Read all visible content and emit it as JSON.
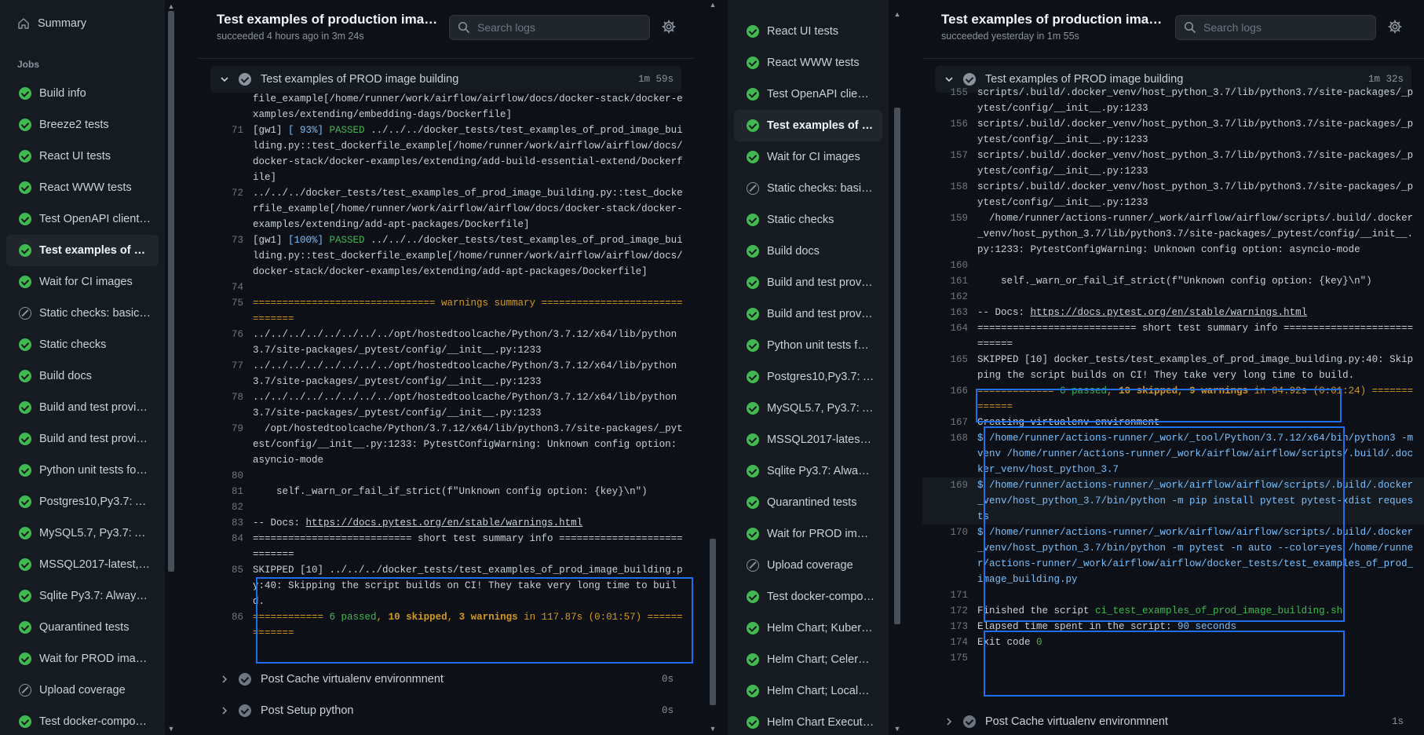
{
  "left_sidebar": {
    "summary_label": "Summary",
    "jobs_heading": "Jobs",
    "jobs": [
      {
        "label": "Build info",
        "status": "success"
      },
      {
        "label": "Breeze2 tests",
        "status": "success"
      },
      {
        "label": "React UI tests",
        "status": "success"
      },
      {
        "label": "React WWW tests",
        "status": "success"
      },
      {
        "label": "Test OpenAPI client …",
        "status": "success"
      },
      {
        "label": "Test examples of pr…",
        "status": "success",
        "active": true
      },
      {
        "label": "Wait for CI images",
        "status": "success"
      },
      {
        "label": "Static checks: basic c…",
        "status": "skipped"
      },
      {
        "label": "Static checks",
        "status": "success"
      },
      {
        "label": "Build docs",
        "status": "success"
      },
      {
        "label": "Build and test provid…",
        "status": "success"
      },
      {
        "label": "Build and test provid…",
        "status": "success"
      },
      {
        "label": "Python unit tests for …",
        "status": "success"
      },
      {
        "label": "Postgres10,Py3.7: Al…",
        "status": "success"
      },
      {
        "label": "MySQL5.7, Py3.7: Al…",
        "status": "success"
      },
      {
        "label": "MSSQL2017-latest, …",
        "status": "success"
      },
      {
        "label": "Sqlite Py3.7: Always …",
        "status": "success"
      },
      {
        "label": "Quarantined tests",
        "status": "success"
      },
      {
        "label": "Wait for PROD images",
        "status": "success"
      },
      {
        "label": "Upload coverage",
        "status": "skipped"
      },
      {
        "label": "Test docker-compose…",
        "status": "success"
      }
    ]
  },
  "left_log": {
    "title": "Test examples of production image …",
    "subtitle": "succeeded 4 hours ago in 3m 24s",
    "search_placeholder": "Search logs",
    "step": {
      "name": "Test examples of PROD image building",
      "duration": "1m 59s"
    },
    "lines": [
      {
        "n": "",
        "segs": [
          {
            "t": "file_example[/home/runner/work/airflow/airflow/docs/docker-stack/docker-examples/extending/embedding-dags/Dockerfile]"
          }
        ]
      },
      {
        "n": "71",
        "segs": [
          {
            "t": "[gw1] "
          },
          {
            "t": "[ 93%]",
            "c": "c"
          },
          {
            "t": " "
          },
          {
            "t": "PASSED",
            "c": "g"
          },
          {
            "t": " ../../../docker_tests/test_examples_of_prod_image_building.py::test_dockerfile_example[/home/runner/work/airflow/airflow/docs/docker-stack/docker-examples/extending/add-build-essential-extend/Dockerfile]"
          }
        ]
      },
      {
        "n": "72",
        "segs": [
          {
            "t": "../../../docker_tests/test_examples_of_prod_image_building.py::test_dockerfile_example[/home/runner/work/airflow/airflow/docs/docker-stack/docker-examples/extending/add-apt-packages/Dockerfile]"
          }
        ]
      },
      {
        "n": "73",
        "segs": [
          {
            "t": "[gw1] "
          },
          {
            "t": "[100%]",
            "c": "c"
          },
          {
            "t": " "
          },
          {
            "t": "PASSED",
            "c": "g"
          },
          {
            "t": " ../../../docker_tests/test_examples_of_prod_image_building.py::test_dockerfile_example[/home/runner/work/airflow/airflow/docs/docker-stack/docker-examples/extending/add-apt-packages/Dockerfile]"
          }
        ]
      },
      {
        "n": "74",
        "segs": [
          {
            "t": ""
          }
        ]
      },
      {
        "n": "75",
        "segs": [
          {
            "t": "=============================== warnings summary ===============================",
            "c": "y"
          }
        ]
      },
      {
        "n": "76",
        "segs": [
          {
            "t": "../../../../../../../../opt/hostedtoolcache/Python/3.7.12/x64/lib/python3.7/site-packages/_pytest/config/__init__.py:1233"
          }
        ]
      },
      {
        "n": "77",
        "segs": [
          {
            "t": "../../../../../../../../opt/hostedtoolcache/Python/3.7.12/x64/lib/python3.7/site-packages/_pytest/config/__init__.py:1233"
          }
        ]
      },
      {
        "n": "78",
        "segs": [
          {
            "t": "../../../../../../../../opt/hostedtoolcache/Python/3.7.12/x64/lib/python3.7/site-packages/_pytest/config/__init__.py:1233"
          }
        ]
      },
      {
        "n": "79",
        "segs": [
          {
            "t": "  /opt/hostedtoolcache/Python/3.7.12/x64/lib/python3.7/site-packages/_pytest/config/__init__.py:1233: PytestConfigWarning: Unknown config option: asyncio-mode"
          }
        ]
      },
      {
        "n": "80",
        "segs": [
          {
            "t": ""
          }
        ]
      },
      {
        "n": "81",
        "segs": [
          {
            "t": "    self._warn_or_fail_if_strict(f\"Unknown config option: {key}\\n\")"
          }
        ]
      },
      {
        "n": "82",
        "segs": [
          {
            "t": ""
          }
        ]
      },
      {
        "n": "83",
        "segs": [
          {
            "t": "-- Docs: "
          },
          {
            "t": "https://docs.pytest.org/en/stable/warnings.html",
            "c": "u"
          }
        ]
      },
      {
        "n": "84",
        "segs": [
          {
            "t": "=========================== short test summary info ============================"
          }
        ]
      },
      {
        "n": "85",
        "segs": [
          {
            "t": "SKIPPED [10] ../../../docker_tests/test_examples_of_prod_image_building.py:40: Skipping the script builds on CI! They take very long time to build."
          }
        ]
      },
      {
        "n": "86",
        "segs": [
          {
            "t": "============ ",
            "c": "y"
          },
          {
            "t": "6 passed",
            "c": "g"
          },
          {
            "t": ", ",
            "c": "y"
          },
          {
            "t": "10 skipped",
            "c": "y b"
          },
          {
            "t": ", ",
            "c": "y"
          },
          {
            "t": "3 warnings",
            "c": "y b"
          },
          {
            "t": " in 117.87s (0:01:57) =============",
            "c": "y"
          }
        ]
      }
    ],
    "post_steps": [
      {
        "name": "Post Cache virtualenv environmnent",
        "duration": "0s"
      },
      {
        "name": "Post Setup python",
        "duration": "0s"
      }
    ]
  },
  "mid_sidebar": {
    "jobs": [
      {
        "label": "React UI tests",
        "status": "success"
      },
      {
        "label": "React WWW tests",
        "status": "success"
      },
      {
        "label": "Test OpenAPI client …",
        "status": "success"
      },
      {
        "label": "Test examples of pr…",
        "status": "success",
        "active": true
      },
      {
        "label": "Wait for CI images",
        "status": "success"
      },
      {
        "label": "Static checks: basic c…",
        "status": "skipped"
      },
      {
        "label": "Static checks",
        "status": "success"
      },
      {
        "label": "Build docs",
        "status": "success"
      },
      {
        "label": "Build and test provid…",
        "status": "success"
      },
      {
        "label": "Build and test provid…",
        "status": "success"
      },
      {
        "label": "Python unit tests for …",
        "status": "success"
      },
      {
        "label": "Postgres10,Py3.7: Al…",
        "status": "success"
      },
      {
        "label": "MySQL5.7, Py3.7: Al…",
        "status": "success"
      },
      {
        "label": "MSSQL2017-latest, …",
        "status": "success"
      },
      {
        "label": "Sqlite Py3.7: Always …",
        "status": "success"
      },
      {
        "label": "Quarantined tests",
        "status": "success"
      },
      {
        "label": "Wait for PROD images",
        "status": "success"
      },
      {
        "label": "Upload coverage",
        "status": "skipped"
      },
      {
        "label": "Test docker-compose…",
        "status": "success"
      },
      {
        "label": "Helm Chart; Kuberne…",
        "status": "success"
      },
      {
        "label": "Helm Chart; CeleryE…",
        "status": "success"
      },
      {
        "label": "Helm Chart; LocalEx…",
        "status": "success"
      },
      {
        "label": "Helm Chart Executor …",
        "status": "success"
      }
    ]
  },
  "right_log": {
    "title": "Test examples of production image …",
    "subtitle": "succeeded yesterday in 1m 55s",
    "search_placeholder": "Search logs",
    "step": {
      "name": "Test examples of PROD image building",
      "duration": "1m 32s"
    },
    "lines": [
      {
        "n": "155",
        "segs": [
          {
            "t": "scripts/.build/.docker_venv/host_python_3.7/lib/python3.7/site-packages/_pytest/config/__init__.py:1233"
          }
        ]
      },
      {
        "n": "156",
        "segs": [
          {
            "t": "scripts/.build/.docker_venv/host_python_3.7/lib/python3.7/site-packages/_pytest/config/__init__.py:1233"
          }
        ]
      },
      {
        "n": "157",
        "segs": [
          {
            "t": "scripts/.build/.docker_venv/host_python_3.7/lib/python3.7/site-packages/_pytest/config/__init__.py:1233"
          }
        ]
      },
      {
        "n": "158",
        "segs": [
          {
            "t": "scripts/.build/.docker_venv/host_python_3.7/lib/python3.7/site-packages/_pytest/config/__init__.py:1233"
          }
        ]
      },
      {
        "n": "159",
        "segs": [
          {
            "t": "  /home/runner/actions-runner/_work/airflow/airflow/scripts/.build/.docker_venv/host_python_3.7/lib/python3.7/site-packages/_pytest/config/__init__.py:1233: PytestConfigWarning: Unknown config option: asyncio-mode"
          }
        ]
      },
      {
        "n": "160",
        "segs": [
          {
            "t": ""
          }
        ]
      },
      {
        "n": "161",
        "segs": [
          {
            "t": "    self._warn_or_fail_if_strict(f\"Unknown config option: {key}\\n\")"
          }
        ]
      },
      {
        "n": "162",
        "segs": [
          {
            "t": ""
          }
        ]
      },
      {
        "n": "163",
        "segs": [
          {
            "t": "-- Docs: "
          },
          {
            "t": "https://docs.pytest.org/en/stable/warnings.html",
            "c": "u"
          }
        ]
      },
      {
        "n": "164",
        "segs": [
          {
            "t": "=========================== short test summary info ============================"
          }
        ]
      },
      {
        "n": "165",
        "segs": [
          {
            "t": "SKIPPED [10] docker_tests/test_examples_of_prod_image_building.py:40: Skipping the script builds on CI! They take very long time to build."
          }
        ]
      },
      {
        "n": "166",
        "segs": [
          {
            "t": "============= ",
            "c": "y"
          },
          {
            "t": "6 passed",
            "c": "g"
          },
          {
            "t": ", ",
            "c": "y"
          },
          {
            "t": "10 skipped",
            "c": "y b"
          },
          {
            "t": ", ",
            "c": "y"
          },
          {
            "t": "9 warnings",
            "c": "y b"
          },
          {
            "t": " in 84.92s (0:01:24) =============",
            "c": "y"
          }
        ]
      },
      {
        "n": "167",
        "segs": [
          {
            "t": "Creating virtualenv environment"
          }
        ]
      },
      {
        "n": "168",
        "segs": [
          {
            "t": "$ /home/runner/actions-runner/_work/_tool/Python/3.7.12/x64/bin/python3 -m venv /home/runner/actions-runner/_work/airflow/airflow/scripts/.build/.docker_venv/host_python_3.7",
            "c": "c"
          }
        ]
      },
      {
        "n": "169",
        "hl": true,
        "segs": [
          {
            "t": "$ /home/runner/actions-runner/_work/airflow/airflow/scripts/.build/.docker_venv/host_python_3.7/bin/python -m pip install pytest pytest-xdist requests",
            "c": "c"
          }
        ]
      },
      {
        "n": "170",
        "segs": [
          {
            "t": "$ /home/runner/actions-runner/_work/airflow/airflow/scripts/.build/.docker_venv/host_python_3.7/bin/python -m pytest -n auto --color=yes /home/runner/actions-runner/_work/airflow/airflow/docker_tests/test_examples_of_prod_image_building.py",
            "c": "c"
          }
        ]
      },
      {
        "n": "171",
        "segs": [
          {
            "t": ""
          }
        ]
      },
      {
        "n": "172",
        "segs": [
          {
            "t": "Finished the script "
          },
          {
            "t": "ci_test_examples_of_prod_image_building.sh",
            "c": "g"
          }
        ]
      },
      {
        "n": "173",
        "segs": [
          {
            "t": "Elapsed time spent in the script: "
          },
          {
            "t": "90 seconds",
            "c": "c"
          }
        ]
      },
      {
        "n": "174",
        "segs": [
          {
            "t": "Exit code "
          },
          {
            "t": "0",
            "c": "g"
          }
        ]
      },
      {
        "n": "175",
        "segs": [
          {
            "t": ""
          }
        ]
      }
    ],
    "post_steps": [
      {
        "name": "Post Cache virtualenv environmnent",
        "duration": "1s"
      }
    ]
  }
}
